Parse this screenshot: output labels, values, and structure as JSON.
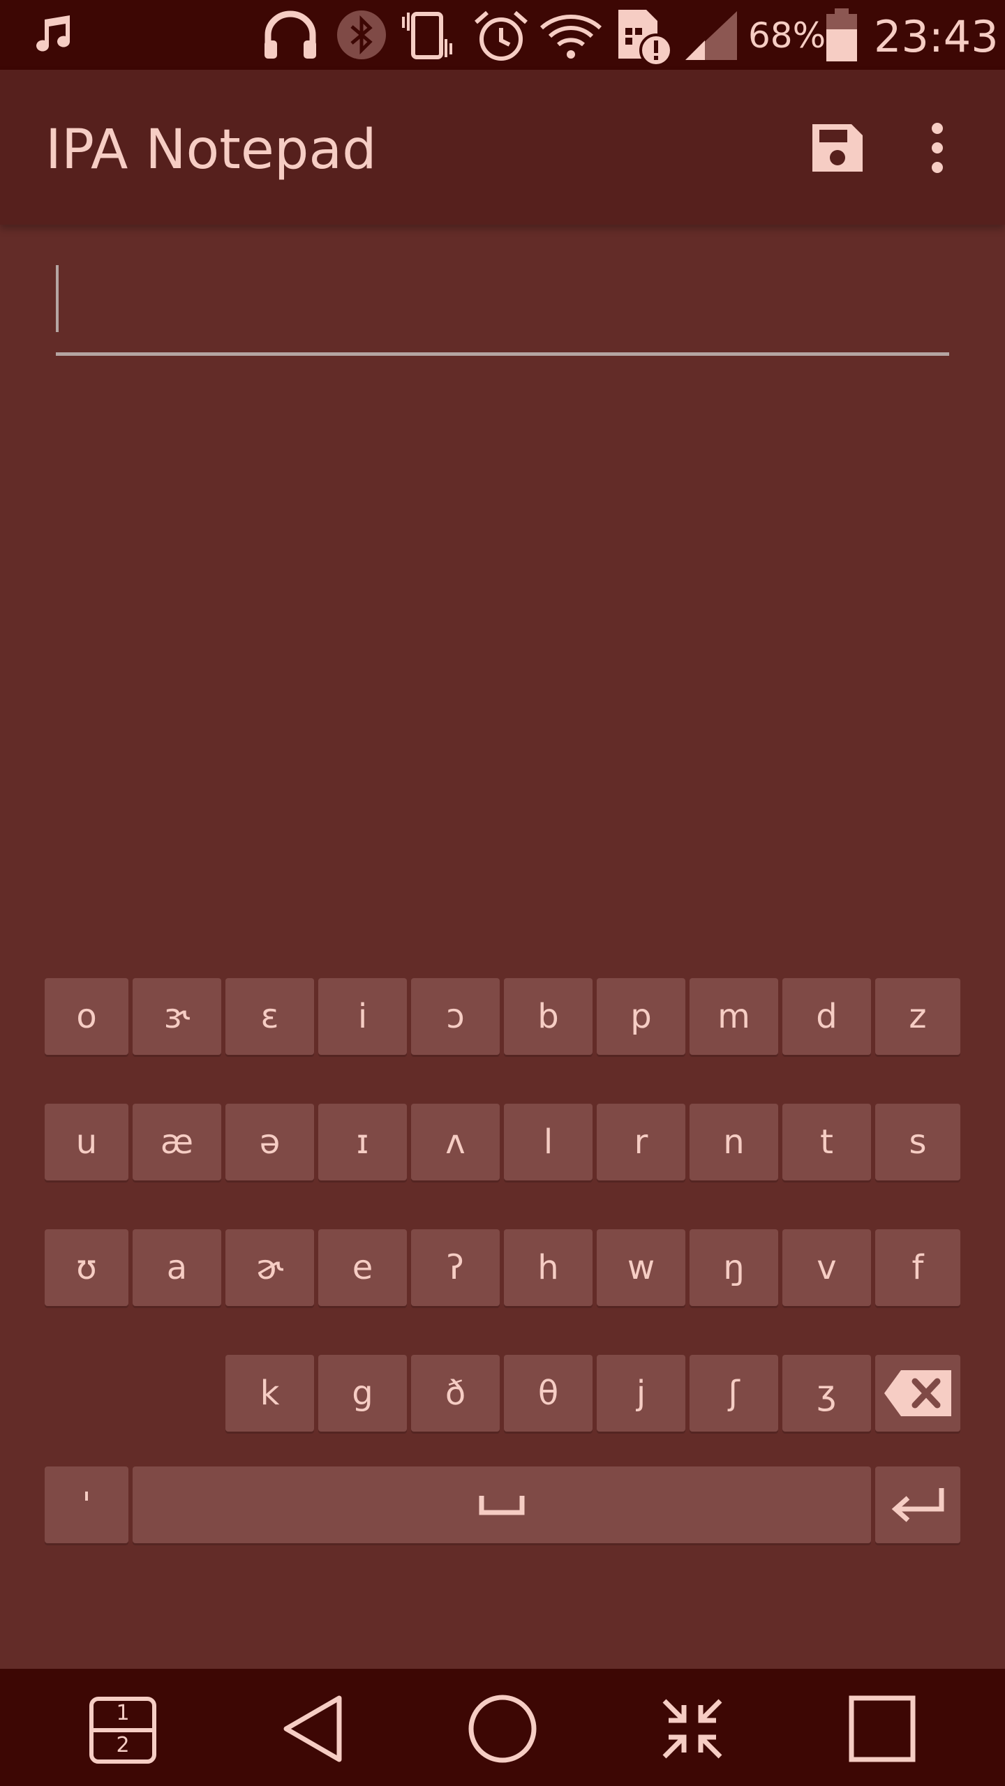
{
  "status_bar": {
    "battery_percent": "68%",
    "time": "23:43",
    "icons": [
      "music-note-icon",
      "headphones-icon",
      "bluetooth-icon",
      "vibrate-icon",
      "alarm-icon",
      "wifi-icon",
      "sim-alert-icon",
      "signal-icon",
      "battery-icon"
    ]
  },
  "app_bar": {
    "title": "IPA Notepad",
    "actions": [
      "save-icon",
      "overflow-menu-icon"
    ]
  },
  "editor": {
    "value": "",
    "placeholder": ""
  },
  "keyboard": {
    "rows": [
      [
        "o",
        "ɝ",
        "ɛ",
        "i",
        "ɔ",
        "b",
        "p",
        "m",
        "d",
        "z"
      ],
      [
        "u",
        "æ",
        "ə",
        "ɪ",
        "ʌ",
        "l",
        "r",
        "n",
        "t",
        "s"
      ],
      [
        "ʊ",
        "a",
        "ɚ",
        "e",
        "ʔ",
        "h",
        "w",
        "ŋ",
        "v",
        "f"
      ],
      [
        "k",
        "g",
        "ð",
        "θ",
        "j",
        "ʃ",
        "ʒ"
      ]
    ],
    "stress_key": "'",
    "space_symbol": "␣",
    "backspace_icon": "backspace-icon",
    "enter_icon": "enter-icon"
  },
  "nav_bar": {
    "dual_window_top": "1",
    "dual_window_bottom": "2",
    "buttons": [
      "dual-window-icon",
      "back-icon",
      "home-icon",
      "mini-view-icon",
      "recents-icon"
    ]
  },
  "colors": {
    "status_bar_bg": "#3d0704",
    "app_bar_bg": "#56201d",
    "page_bg": "#632c28",
    "key_bg": "#7f4a46",
    "text": "#f6cdc4"
  }
}
